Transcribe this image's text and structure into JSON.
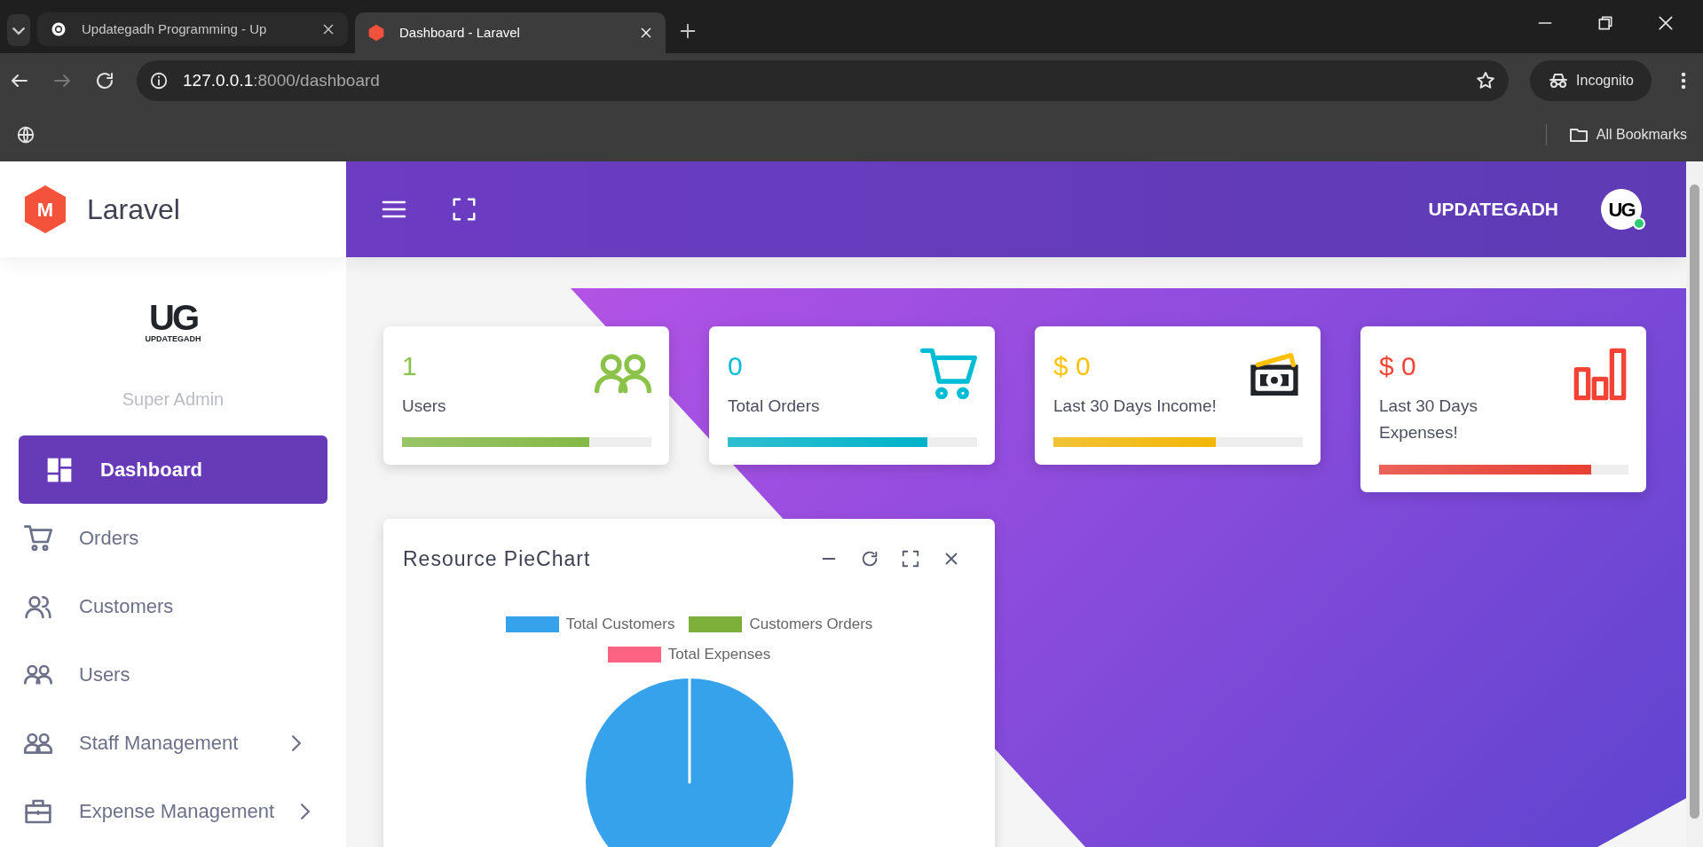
{
  "browser": {
    "tabs": [
      {
        "title": "Updategadh Programming - Up",
        "kind": "site",
        "selected": false
      },
      {
        "title": "Dashboard - Laravel",
        "kind": "app",
        "selected": true
      }
    ],
    "url_host": "127.0.0.1",
    "url_path": ":8000/dashboard",
    "profile": "Incognito",
    "bookmarks_label": "All Bookmarks"
  },
  "sidebar": {
    "brand_letter": "M",
    "brand": "Laravel",
    "logo_text": "UG",
    "logo_subtext": "UPDATEGADH",
    "role": "Super Admin",
    "items": [
      {
        "label": "Dashboard",
        "kind": "dashboard",
        "selected": true,
        "submenu": false
      },
      {
        "label": "Orders",
        "kind": "cart",
        "selected": false,
        "submenu": false
      },
      {
        "label": "Customers",
        "kind": "people",
        "selected": false,
        "submenu": false
      },
      {
        "label": "Users",
        "kind": "users",
        "selected": false,
        "submenu": false
      },
      {
        "label": "Staff Management",
        "kind": "group",
        "selected": false,
        "submenu": true
      },
      {
        "label": "Expense Management",
        "kind": "briefcase",
        "selected": false,
        "submenu": true
      }
    ]
  },
  "header": {
    "username": "UPDATEGADH",
    "avatar_text": "UG",
    "online": true
  },
  "stats": [
    {
      "value": "1",
      "label": "Users",
      "kind": "users",
      "color": "#8bc34a",
      "level": 0.75
    },
    {
      "value": "0",
      "label": "Total Orders",
      "kind": "cart",
      "color": "#00bcd4",
      "level": 0.8
    },
    {
      "value": "$ 0",
      "label": "Last 30 Days Income!",
      "kind": "money",
      "color": "#ffc107",
      "level": 0.65
    },
    {
      "value": "$ 0",
      "label": "Last 30 Days Expenses!",
      "kind": "chart",
      "color": "#f44336",
      "level": 0.85
    }
  ],
  "chart_panel": {
    "title": "Resource PieChart",
    "legend": [
      {
        "label": "Total Customers",
        "color": "#36a2eb"
      },
      {
        "label": "Customers Orders",
        "color": "#7cb03b"
      },
      {
        "label": "Total Expenses",
        "color": "#ff6384"
      }
    ]
  }
}
